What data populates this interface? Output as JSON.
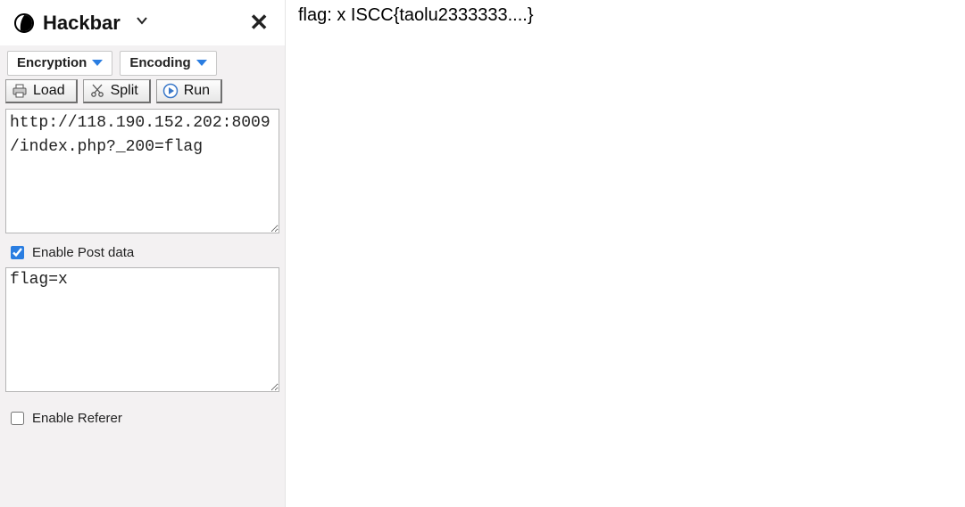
{
  "header": {
    "title": "Hackbar",
    "close_label": "✕"
  },
  "dropdowns": {
    "encryption": "Encryption",
    "encoding": "Encoding"
  },
  "actions": {
    "load": "Load",
    "split": "Split",
    "run": "Run"
  },
  "url_textarea": {
    "value": "http://118.190.152.202:8009/index.php?_200=flag"
  },
  "postdata": {
    "enable_label": "Enable Post data",
    "enabled": true,
    "textarea_value": "flag=x"
  },
  "referer": {
    "enable_label": "Enable Referer",
    "enabled": false
  },
  "content": {
    "flag_text": "flag: x ISCC{taolu2333333....}"
  }
}
